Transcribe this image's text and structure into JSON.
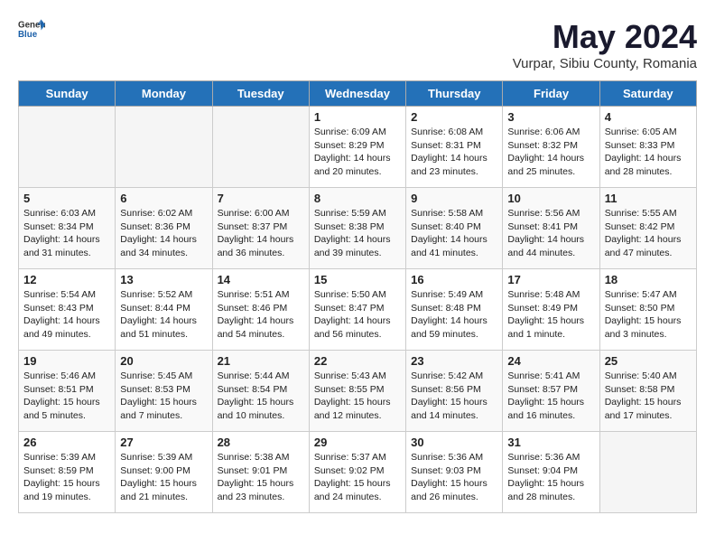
{
  "logo": {
    "text_general": "General",
    "text_blue": "Blue"
  },
  "title": "May 2024",
  "subtitle": "Vurpar, Sibiu County, Romania",
  "days_of_week": [
    "Sunday",
    "Monday",
    "Tuesday",
    "Wednesday",
    "Thursday",
    "Friday",
    "Saturday"
  ],
  "weeks": [
    [
      {
        "day": "",
        "info": ""
      },
      {
        "day": "",
        "info": ""
      },
      {
        "day": "",
        "info": ""
      },
      {
        "day": "1",
        "info": "Sunrise: 6:09 AM\nSunset: 8:29 PM\nDaylight: 14 hours\nand 20 minutes."
      },
      {
        "day": "2",
        "info": "Sunrise: 6:08 AM\nSunset: 8:31 PM\nDaylight: 14 hours\nand 23 minutes."
      },
      {
        "day": "3",
        "info": "Sunrise: 6:06 AM\nSunset: 8:32 PM\nDaylight: 14 hours\nand 25 minutes."
      },
      {
        "day": "4",
        "info": "Sunrise: 6:05 AM\nSunset: 8:33 PM\nDaylight: 14 hours\nand 28 minutes."
      }
    ],
    [
      {
        "day": "5",
        "info": "Sunrise: 6:03 AM\nSunset: 8:34 PM\nDaylight: 14 hours\nand 31 minutes."
      },
      {
        "day": "6",
        "info": "Sunrise: 6:02 AM\nSunset: 8:36 PM\nDaylight: 14 hours\nand 34 minutes."
      },
      {
        "day": "7",
        "info": "Sunrise: 6:00 AM\nSunset: 8:37 PM\nDaylight: 14 hours\nand 36 minutes."
      },
      {
        "day": "8",
        "info": "Sunrise: 5:59 AM\nSunset: 8:38 PM\nDaylight: 14 hours\nand 39 minutes."
      },
      {
        "day": "9",
        "info": "Sunrise: 5:58 AM\nSunset: 8:40 PM\nDaylight: 14 hours\nand 41 minutes."
      },
      {
        "day": "10",
        "info": "Sunrise: 5:56 AM\nSunset: 8:41 PM\nDaylight: 14 hours\nand 44 minutes."
      },
      {
        "day": "11",
        "info": "Sunrise: 5:55 AM\nSunset: 8:42 PM\nDaylight: 14 hours\nand 47 minutes."
      }
    ],
    [
      {
        "day": "12",
        "info": "Sunrise: 5:54 AM\nSunset: 8:43 PM\nDaylight: 14 hours\nand 49 minutes."
      },
      {
        "day": "13",
        "info": "Sunrise: 5:52 AM\nSunset: 8:44 PM\nDaylight: 14 hours\nand 51 minutes."
      },
      {
        "day": "14",
        "info": "Sunrise: 5:51 AM\nSunset: 8:46 PM\nDaylight: 14 hours\nand 54 minutes."
      },
      {
        "day": "15",
        "info": "Sunrise: 5:50 AM\nSunset: 8:47 PM\nDaylight: 14 hours\nand 56 minutes."
      },
      {
        "day": "16",
        "info": "Sunrise: 5:49 AM\nSunset: 8:48 PM\nDaylight: 14 hours\nand 59 minutes."
      },
      {
        "day": "17",
        "info": "Sunrise: 5:48 AM\nSunset: 8:49 PM\nDaylight: 15 hours\nand 1 minute."
      },
      {
        "day": "18",
        "info": "Sunrise: 5:47 AM\nSunset: 8:50 PM\nDaylight: 15 hours\nand 3 minutes."
      }
    ],
    [
      {
        "day": "19",
        "info": "Sunrise: 5:46 AM\nSunset: 8:51 PM\nDaylight: 15 hours\nand 5 minutes."
      },
      {
        "day": "20",
        "info": "Sunrise: 5:45 AM\nSunset: 8:53 PM\nDaylight: 15 hours\nand 7 minutes."
      },
      {
        "day": "21",
        "info": "Sunrise: 5:44 AM\nSunset: 8:54 PM\nDaylight: 15 hours\nand 10 minutes."
      },
      {
        "day": "22",
        "info": "Sunrise: 5:43 AM\nSunset: 8:55 PM\nDaylight: 15 hours\nand 12 minutes."
      },
      {
        "day": "23",
        "info": "Sunrise: 5:42 AM\nSunset: 8:56 PM\nDaylight: 15 hours\nand 14 minutes."
      },
      {
        "day": "24",
        "info": "Sunrise: 5:41 AM\nSunset: 8:57 PM\nDaylight: 15 hours\nand 16 minutes."
      },
      {
        "day": "25",
        "info": "Sunrise: 5:40 AM\nSunset: 8:58 PM\nDaylight: 15 hours\nand 17 minutes."
      }
    ],
    [
      {
        "day": "26",
        "info": "Sunrise: 5:39 AM\nSunset: 8:59 PM\nDaylight: 15 hours\nand 19 minutes."
      },
      {
        "day": "27",
        "info": "Sunrise: 5:39 AM\nSunset: 9:00 PM\nDaylight: 15 hours\nand 21 minutes."
      },
      {
        "day": "28",
        "info": "Sunrise: 5:38 AM\nSunset: 9:01 PM\nDaylight: 15 hours\nand 23 minutes."
      },
      {
        "day": "29",
        "info": "Sunrise: 5:37 AM\nSunset: 9:02 PM\nDaylight: 15 hours\nand 24 minutes."
      },
      {
        "day": "30",
        "info": "Sunrise: 5:36 AM\nSunset: 9:03 PM\nDaylight: 15 hours\nand 26 minutes."
      },
      {
        "day": "31",
        "info": "Sunrise: 5:36 AM\nSunset: 9:04 PM\nDaylight: 15 hours\nand 28 minutes."
      },
      {
        "day": "",
        "info": ""
      }
    ]
  ]
}
